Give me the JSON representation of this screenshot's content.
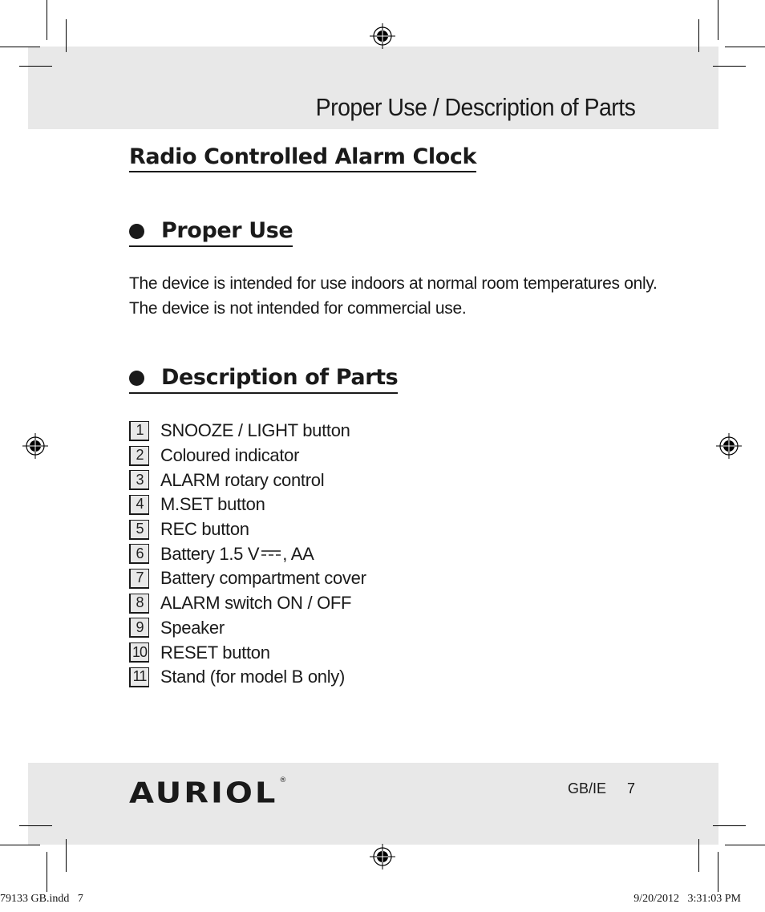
{
  "header": {
    "title": "Proper Use / Description of Parts"
  },
  "document": {
    "title": "Radio Controlled Alarm Clock"
  },
  "sections": {
    "proper_use": {
      "heading": "Proper Use",
      "text": "The device is intended for use indoors at normal room temperatures only. The device is not intended for commercial use."
    },
    "description_of_parts": {
      "heading": "Description of Parts",
      "parts": [
        {
          "number": "1",
          "label": "SNOOZE / LIGHT button"
        },
        {
          "number": "2",
          "label": "Coloured indicator"
        },
        {
          "number": "3",
          "label": "ALARM rotary control"
        },
        {
          "number": "4",
          "label": "M.SET button"
        },
        {
          "number": "5",
          "label": "REC button"
        },
        {
          "number": "6",
          "label_before": "Battery 1.5 V",
          "icon": "direct-current-symbol",
          "label_after": ", AA"
        },
        {
          "number": "7",
          "label": "Battery compartment cover"
        },
        {
          "number": "8",
          "label": "ALARM switch ON / OFF"
        },
        {
          "number": "9",
          "label": "Speaker"
        },
        {
          "number": "10",
          "label": "RESET button"
        },
        {
          "number": "11",
          "label": "Stand (for model B only)"
        }
      ]
    }
  },
  "footer": {
    "brand": "AURIOL",
    "registered_mark": "®",
    "locale": "GB/IE",
    "page_number": "7"
  },
  "print_slug": {
    "file": "79133 GB.indd   7",
    "timestamp": "9/20/2012   3:31:03 PM"
  },
  "colors": {
    "band_gray": "#e8e8e8",
    "text": "#1a1a1a"
  }
}
